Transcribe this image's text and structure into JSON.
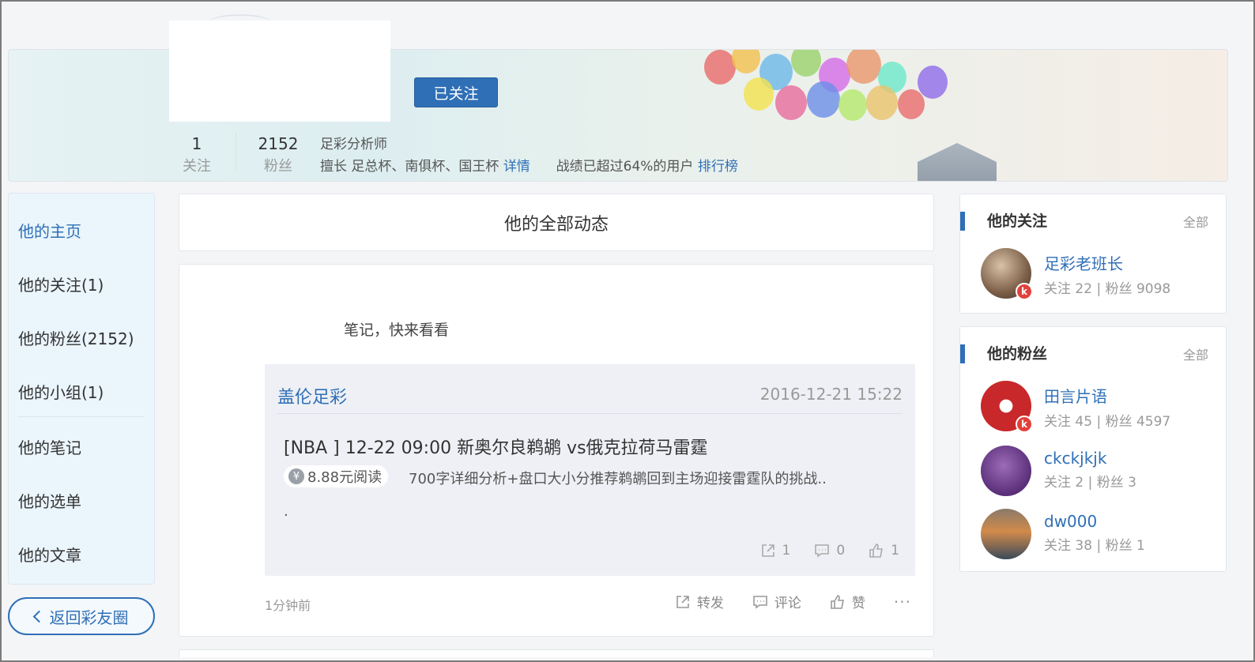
{
  "profile": {
    "follow_button": "已关注",
    "following_count": "1",
    "following_label": "关注",
    "fans_count": "2152",
    "fans_label": "粉丝",
    "title": "足彩分析师",
    "specialty_prefix": "擅长 足总杯、南俱杯、国王杯",
    "details_link": "详情",
    "record_text": "战绩已超过64%的用户",
    "ranking_link": "排行榜"
  },
  "nav": {
    "items": [
      "他的主页",
      "他的关注(1)",
      "他的粉丝(2152)",
      "他的小组(1)",
      "他的笔记",
      "他的选单",
      "他的文章"
    ],
    "back_button": "返回彩友圈"
  },
  "feed": {
    "tab_title": "他的全部动态",
    "post_text": "笔记，快来看看",
    "quote": {
      "author": "盖伦足彩",
      "time": "2016-12-21 15:22",
      "title": "[NBA ] 12-22 09:00 新奥尔良鹈鹕 vs俄克拉荷马雷霆",
      "price": "8.88元阅读",
      "price_icon": "¥",
      "description": "700字详细分析+盘口大小分推荐鹈鹕回到主场迎接雷霆队的挑战..",
      "tail": ".",
      "share_count": "1",
      "comment_count": "0",
      "like_count": "1"
    },
    "post_time": "1分钟前",
    "actions": {
      "share": "转发",
      "comment": "评论",
      "like": "赞",
      "more": "···"
    }
  },
  "following_card": {
    "title": "他的关注",
    "all_link": "全部",
    "users": [
      {
        "name": "足彩老班长",
        "stats": "关注 22 | 粉丝 9098",
        "badge": "k"
      }
    ]
  },
  "fans_card": {
    "title": "他的粉丝",
    "all_link": "全部",
    "users": [
      {
        "name": "田言片语",
        "stats": "关注 45 | 粉丝 4597",
        "badge": "k"
      },
      {
        "name": "ckckjkjk",
        "stats": "关注 2 | 粉丝 3"
      },
      {
        "name": "dw000",
        "stats": "关注 38 | 粉丝 1"
      }
    ]
  },
  "colors": {
    "accent": "#2f6fb6",
    "badge": "#e2413b"
  }
}
